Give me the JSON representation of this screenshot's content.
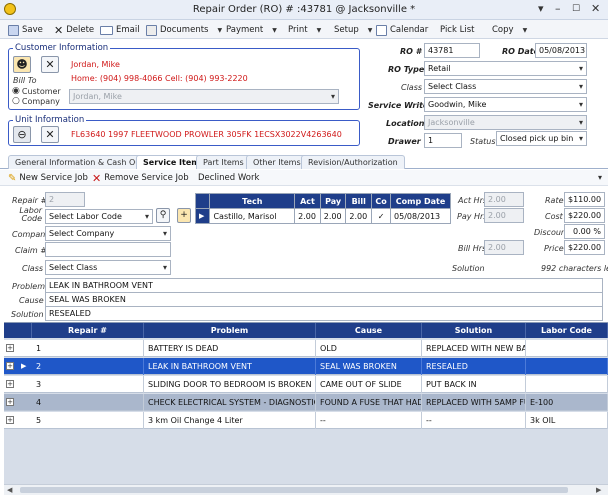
{
  "window": {
    "title": "Repair Order (RO) # :43781 @ Jacksonville *",
    "min": "–",
    "max": "☐",
    "close": "✕",
    "menu": "▾"
  },
  "toolbar": {
    "save": "Save",
    "delete": "Delete",
    "email": "Email",
    "documents": "Documents",
    "payment": "Payment",
    "print": "Print",
    "setup": "Setup",
    "calendar": "Calendar",
    "pick_list": "Pick List",
    "copy": "Copy"
  },
  "customer": {
    "title": "Customer Information",
    "name": "Jordan, Mike",
    "phones": "Home: (904) 998-4066 Cell: (904) 993-2220",
    "bill_to_label": "Bill To",
    "customer_option": "Customer",
    "company_option": "Company",
    "bill_to_value": "Jordan, Mike"
  },
  "unit": {
    "title": "Unit Information",
    "desc": "FL63640 1997 FLEETWOOD PROWLER 305FK 1ECSX3022V4263640"
  },
  "ro": {
    "ro_label": "RO #",
    "ro_value": "43781",
    "date_label": "RO Date",
    "date_value": "05/08/2013",
    "type_label": "RO Type",
    "type_value": "Retail",
    "class_label": "Class",
    "class_value": "Select Class",
    "writer_label": "Service Writer",
    "writer_value": "Goodwin, Mike",
    "location_label": "Location",
    "location_value": "Jacksonville",
    "drawer_label": "Drawer #",
    "drawer_value": "1",
    "status_label": "Status",
    "status_value": "Closed pick up bin"
  },
  "tabs": [
    "General Information & Cash Out",
    "Service Items",
    "Part Items",
    "Other Items",
    "Revision/Authorization"
  ],
  "subbar": {
    "new_job": "New Service Job",
    "remove_job": "Remove Service Job",
    "declined": "Declined Work"
  },
  "job": {
    "repair_label": "Repair #",
    "repair_value": "2",
    "labor_label": "Labor Code",
    "labor_value": "Select Labor Code",
    "company_label": "Company",
    "company_value": "Select Company",
    "claim_label": "Claim #",
    "claim_value": "",
    "class_label": "Class",
    "class_value": "Select Class",
    "problem_label": "Problem",
    "problem_value": "LEAK IN BATHROOM VENT",
    "cause_label": "Cause",
    "cause_value": "SEAL WAS BROKEN",
    "solution_label": "Solution",
    "solution_value": "RESEALED",
    "solution_hint": "Solution",
    "chars_left": "992 characters left"
  },
  "tech_table": {
    "headers": [
      "Tech",
      "Act",
      "Pay",
      "Bill",
      "Co",
      "Comp Date"
    ],
    "row": {
      "tech": "Castillo, Marisol",
      "act": "2.00",
      "pay": "2.00",
      "bill": "2.00",
      "co": "✓",
      "date": "05/08/2013"
    }
  },
  "hours": {
    "act_label": "Act Hrs",
    "act_value": "2.00",
    "pay_label": "Pay Hrs",
    "pay_value": "2.00",
    "bill_label": "Bill Hrs",
    "bill_value": "2.00"
  },
  "pricing": {
    "rate_label": "Rate",
    "rate_value": "$110.00",
    "cost_label": "Cost",
    "cost_value": "$220.00",
    "discount_label": "Discount",
    "discount_value": "0.00 %",
    "price_label": "Price",
    "price_value": "$220.00"
  },
  "grid": {
    "headers": [
      "Repair #",
      "Problem",
      "Cause",
      "Solution",
      "Labor Code"
    ],
    "rows": [
      {
        "repair": "1",
        "problem": "BATTERY IS DEAD",
        "cause": "OLD",
        "solution": "REPLACED WITH NEW BAT",
        "labor": ""
      },
      {
        "repair": "2",
        "problem": "LEAK IN BATHROOM VENT",
        "cause": "SEAL WAS BROKEN",
        "solution": "RESEALED",
        "labor": ""
      },
      {
        "repair": "3",
        "problem": "SLIDING DOOR TO BEDROOM IS BROKEN",
        "cause": "CAME OUT OF SLIDE",
        "solution": "PUT BACK IN",
        "labor": ""
      },
      {
        "repair": "4",
        "problem": "CHECK ELECTRICAL SYSTEM - DIAGNOSTIC",
        "cause": "FOUND A FUSE THAT HAD",
        "solution": "REPLACED WITH 5AMP FUS",
        "labor": "E-100"
      },
      {
        "repair": "5",
        "problem": "3 km Oil Change 4 Liter",
        "cause": "--",
        "solution": "--",
        "labor": "3k OIL"
      }
    ]
  }
}
